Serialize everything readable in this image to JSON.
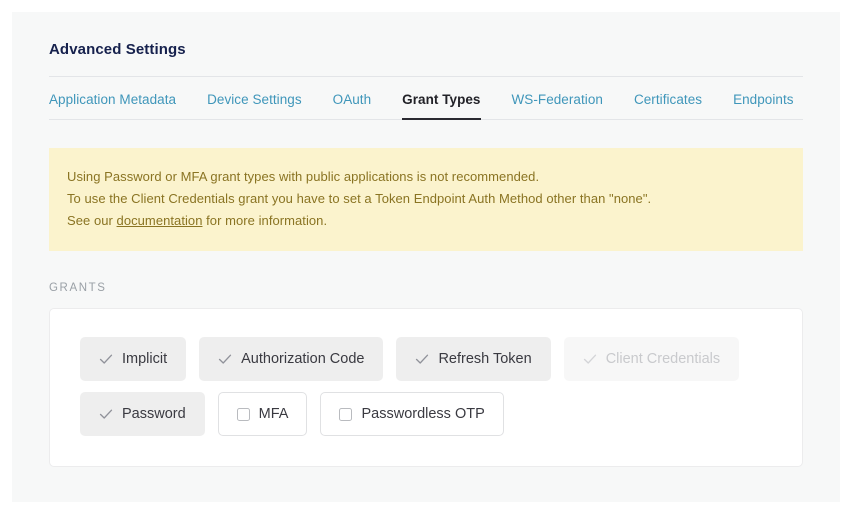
{
  "header": {
    "title": "Advanced Settings"
  },
  "tabs": [
    {
      "label": "Application Metadata",
      "active": false
    },
    {
      "label": "Device Settings",
      "active": false
    },
    {
      "label": "OAuth",
      "active": false
    },
    {
      "label": "Grant Types",
      "active": true
    },
    {
      "label": "WS-Federation",
      "active": false
    },
    {
      "label": "Certificates",
      "active": false
    },
    {
      "label": "Endpoints",
      "active": false
    }
  ],
  "banner": {
    "line1": "Using Password or MFA grant types with public applications is not recommended.",
    "line2": "To use the Client Credentials grant you have to set a Token Endpoint Auth Method other than \"none\".",
    "line3_prefix": "See our ",
    "link_label": "documentation",
    "line3_suffix": " for more information.",
    "background_color": "#fbf3cd",
    "text_color": "#8a7423"
  },
  "grants": {
    "section_label": "GRANTS",
    "rows": [
      [
        {
          "label": "Implicit",
          "state": "selected",
          "icon": "check-icon"
        },
        {
          "label": "Authorization Code",
          "state": "selected",
          "icon": "check-icon"
        },
        {
          "label": "Refresh Token",
          "state": "selected",
          "icon": "check-icon"
        },
        {
          "label": "Client Credentials",
          "state": "disabled",
          "icon": "check-icon"
        }
      ],
      [
        {
          "label": "Password",
          "state": "selected",
          "icon": "check-icon"
        },
        {
          "label": "MFA",
          "state": "unselected",
          "icon": "checkbox-empty-icon"
        },
        {
          "label": "Passwordless OTP",
          "state": "unselected",
          "icon": "checkbox-empty-icon"
        }
      ]
    ]
  },
  "colors": {
    "tab_link": "#3f96ba",
    "tab_active": "#222228",
    "panel_background": "#f7f8f8",
    "chip_selected_background": "#eeeeee"
  }
}
